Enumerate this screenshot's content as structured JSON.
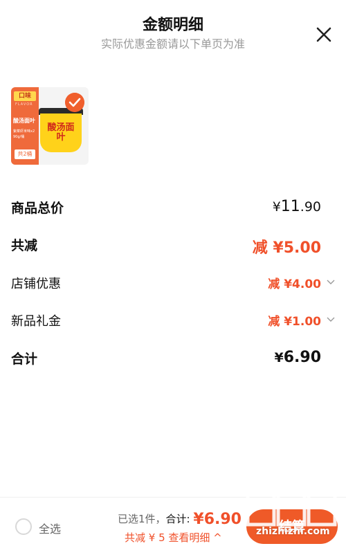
{
  "header": {
    "title": "金额明细",
    "subtitle": "实际优惠金额请以下单页为准"
  },
  "product": {
    "badge_top": "口味",
    "badge_en": "FLAVOR",
    "name": "酸汤面叶",
    "desc": "紫菜虾米味x2 90g/桶",
    "count": "共2桶",
    "tub_text": "酸汤面叶"
  },
  "rows": {
    "goods_total": {
      "label": "商品总价",
      "currency": "¥",
      "int": "11",
      "dec": ".90"
    },
    "total_reduce": {
      "label": "共减",
      "value": "减 ¥5.00"
    },
    "store_discount": {
      "label": "店铺优惠",
      "value": "减 ¥4.00"
    },
    "new_gift": {
      "label": "新品礼金",
      "value": "减 ¥1.00"
    },
    "sum": {
      "label": "合计",
      "currency": "¥",
      "value": "6.90"
    }
  },
  "bottom": {
    "select_all": "全选",
    "selected": "已选1件，",
    "total_label": "合计:",
    "currency": "¥",
    "total_value": "6.90",
    "reduce_detail": "共减 ¥ 5  查看明细 ^",
    "checkout": "结算"
  },
  "watermark": {
    "text": "值值值",
    "url": "zhizhizhi.com"
  },
  "colors": {
    "accent": "#f0502a",
    "text": "#111111",
    "muted": "#999999"
  }
}
